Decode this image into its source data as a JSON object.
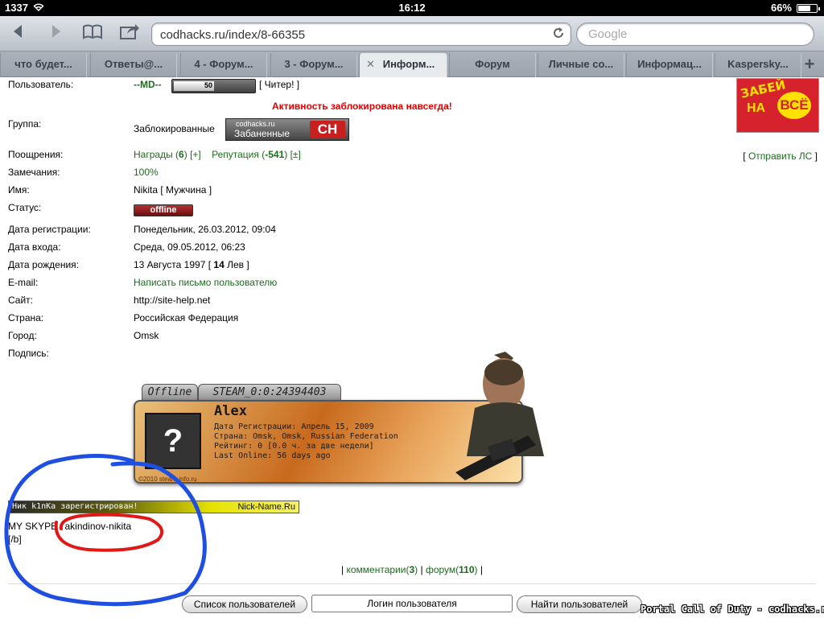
{
  "statusbar": {
    "carrier": "1337",
    "time": "16:12",
    "battery": "66%"
  },
  "toolbar": {
    "back_icon": "back-arrow-icon",
    "forward_icon": "forward-arrow-icon",
    "bookmarks_icon": "book-icon",
    "share_icon": "share-icon",
    "url": "codhacks.ru/index/8-66355",
    "search_placeholder": "Google"
  },
  "tabs": [
    {
      "label": "что будет..."
    },
    {
      "label": "Ответы@..."
    },
    {
      "label": "4 - Форум..."
    },
    {
      "label": "3 - Форум..."
    },
    {
      "label": "Информ...",
      "active": true
    },
    {
      "label": "Форум"
    },
    {
      "label": "Личные со..."
    },
    {
      "label": "Информац..."
    },
    {
      "label": "Kaspersky..."
    }
  ],
  "profile": {
    "user_label": "Пользователь:",
    "user_name": "--MD--",
    "userbar_value": "50",
    "cheater": "[ Читер! ]",
    "blocked_notice": "Активность заблокирована навсегда!",
    "group_label": "Группа:",
    "group_value": "Заблокированные",
    "group_badge_small": "codhacks.ru",
    "group_badge_big": "Забаненные",
    "group_badge_logo": "CH",
    "rewards_label": "Поощрения:",
    "rewards_text": "Награды",
    "rewards_count": "6",
    "rewards_add": "[+]",
    "reputation_text": "Репутация",
    "reputation_value": "-541",
    "reputation_pm": "[±]",
    "send_pm": "Отправить ЛС",
    "warnings_label": "Замечания:",
    "warnings_value": "100%",
    "name_label": "Имя:",
    "name_value": "Nikita [ Мужчина ]",
    "status_label": "Статус:",
    "status_value": "offline",
    "reg_label": "Дата регистрации:",
    "reg_value": "Понедельник, 26.03.2012, 09:04",
    "login_label": "Дата входа:",
    "login_value": "Среда, 09.05.2012, 06:23",
    "birth_label": "Дата рождения:",
    "birth_value": "13 Августа 1997 [",
    "birth_age": "14",
    "birth_sign": "Лев ]",
    "email_label": "E-mail:",
    "email_value": "Написать письмо пользователю",
    "site_label": "Сайт:",
    "site_value": "http://site-help.net",
    "country_label": "Страна:",
    "country_value": "Российская Федерация",
    "city_label": "Город:",
    "city_value": "Omsk",
    "signature_label": "Подпись:"
  },
  "avatar_corner": {
    "t1": "ЗАБЕЙ",
    "t2": "НА",
    "t3": "ВСЁ"
  },
  "steam": {
    "tab_status": "Offline",
    "tab_id": "STEAM_0:0:24394403",
    "avatar": "?",
    "name": "Alex",
    "line1": "Дата Регистрации: Апрель 15, 2009",
    "line2": "Страна: Omsk, Omsk, Russian Federation",
    "line3": "Рейтинг: 0 [0.0 ч. за две недели]",
    "line4": "Last Online: 56 days ago",
    "credit": "©2010 steam-info.ru"
  },
  "signature": {
    "nick_bar_left": "Ник k1nKa зарегистрирован!",
    "nick_bar_right": "Nick-Name.Ru",
    "skype_label": "MY SKYPE",
    "skype_value": "akindinov-nikita",
    "tag": "[/b]"
  },
  "footer": {
    "comments_text": "комментарии",
    "comments_count": "3",
    "forum_text": "форум",
    "forum_count": "110",
    "btn_list": "Список пользователей",
    "input_login": "Логин пользователя",
    "btn_find": "Найти пользователей",
    "watermark": "Portal Call of Duty - codhacks.ru"
  },
  "colors": {
    "link_green": "#1d6b1d",
    "alert_red": "#e00000",
    "circle_blue": "#1f4fe0",
    "circle_red": "#e01818"
  }
}
